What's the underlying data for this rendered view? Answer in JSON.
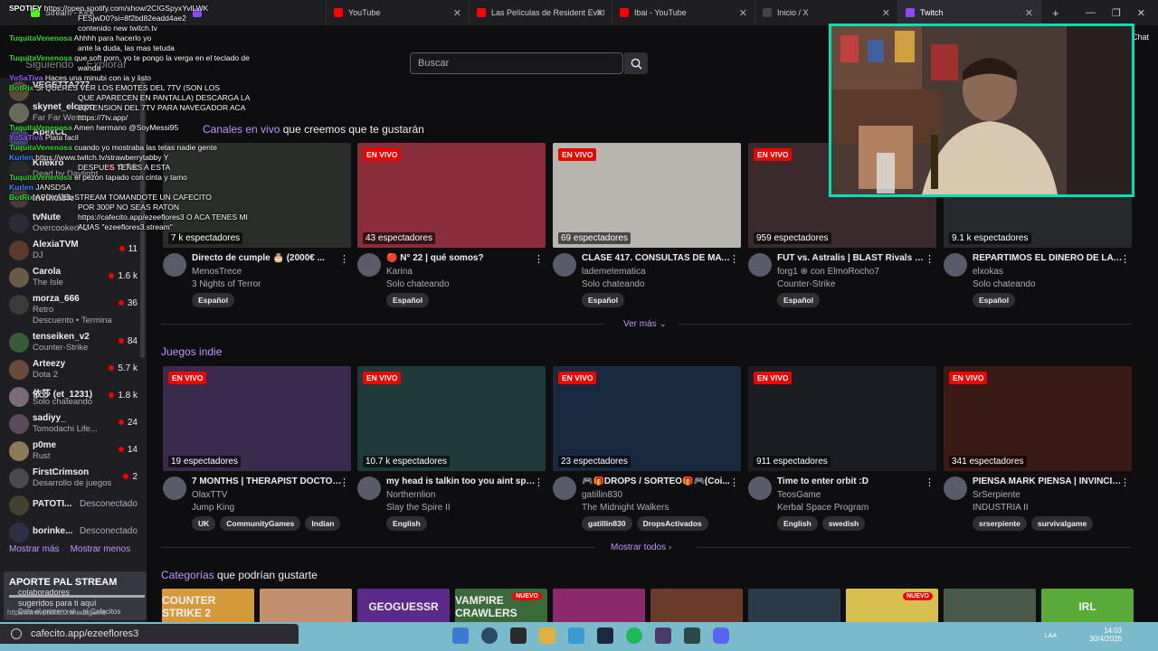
{
  "browser": {
    "tabs": [
      {
        "label": "Stream - Kick",
        "color": "#53fc18"
      },
      {
        "label": "YouTube",
        "color": "#ff0000"
      },
      {
        "label": "Las Películas de Resident Evil NO",
        "color": "#ff0000"
      },
      {
        "label": "Ibai - YouTube",
        "color": "#ff0000"
      },
      {
        "label": "Inicio / X",
        "color": "#444444"
      },
      {
        "label": "Twitch",
        "color": "#9146ff"
      }
    ],
    "new_tab": "+",
    "url": "cafecito.app/ezeeflores3",
    "status_url": "https://www.twitch.tv/tedsgame"
  },
  "header": {
    "search_placeholder": "Buscar",
    "chat_label": "Chat",
    "nav_items": [
      "Siguiendo",
      "Explorar"
    ]
  },
  "sidebar": {
    "items": [
      {
        "name": "VEGETTA777",
        "game": "",
        "count": ""
      },
      {
        "name": "skynet_elcapo",
        "game": "Far Far West",
        "count": ""
      },
      {
        "name": "ApexCL",
        "game": "",
        "count": ""
      },
      {
        "name": "Knekro",
        "game": "Dead by Daylight",
        "count": "4.7 k"
      },
      {
        "name": "Invincible",
        "game": "",
        "count": ""
      },
      {
        "name": "tvNute",
        "game": "Overcooked! 2",
        "count": ""
      },
      {
        "name": "AlexiaTVM",
        "game": "DJ",
        "count": "11"
      },
      {
        "name": "Carola",
        "game": "The Isle",
        "count": "1.6 k"
      },
      {
        "name": "morza_666",
        "game": "Retro",
        "count": "36"
      },
      {
        "name": "Descuento • Termina",
        "game": "",
        "count": ""
      },
      {
        "name": "tenseiken_v2",
        "game": "Counter-Strike",
        "count": "84"
      },
      {
        "name": "Arteezy",
        "game": "Dota 2",
        "count": "5.7 k"
      },
      {
        "name": "依莎 (et_1231)",
        "game": "Solo chateando",
        "count": "1.8 k"
      },
      {
        "name": "sadiyy_",
        "game": "Tomodachi Life...",
        "count": "24"
      },
      {
        "name": "p0me",
        "game": "Rust",
        "count": "14"
      },
      {
        "name": "FirstCrimson",
        "game": "Desarrollo de juegos",
        "count": "2"
      },
      {
        "name": "PATOTI...",
        "game": "",
        "count": "",
        "status": "Desconectado"
      },
      {
        "name": "borinke...",
        "game": "",
        "count": "",
        "status": "Desconectado"
      }
    ],
    "show_more": "Mostrar más",
    "show_less": "Mostrar menos"
  },
  "chat_overlay": [
    {
      "user": "SPOTIFY",
      "text": "https://open.spotify.com/show/2CIGSpyxYvlLWK"
    },
    {
      "user": "",
      "text": "FESjwD0?si=8f2bd82eadd4ae2"
    },
    {
      "user": "",
      "text": "contenido new twitch.tv"
    },
    {
      "user": "TuquitaVenenosa",
      "text": "Ahhhh para hacerlo yo"
    },
    {
      "user": "",
      "text": "ante la duda, las mas tetuda"
    },
    {
      "user": "TuquitaVenenosa",
      "text": "que soft porn, yo te pongo la verga en el teclado de"
    },
    {
      "user": "",
      "text": "wanda"
    },
    {
      "user": "YoSaTiva",
      "text": "Haces una minubi con ia y listo"
    },
    {
      "user": "BotRix",
      "text": "SI QUERES VER LOS EMOTES DEL 7TV (SON LOS"
    },
    {
      "user": "",
      "text": "QUE APARECEN EN PANTALLA) DESCARGA LA"
    },
    {
      "user": "",
      "text": "EXTENSION DEL 7TV PARA NAVEGADOR ACA"
    },
    {
      "user": "",
      "text": "https://7tv.app/"
    },
    {
      "user": "TuquitaVenenosa",
      "text": "Amen hermano @SoyMessi95"
    },
    {
      "user": "YoSaTiva",
      "text": "Plata facil"
    },
    {
      "user": "TuquitaVenenosa",
      "text": "cuando yo mostraba las tetas nadie gente"
    },
    {
      "user": "Kurlen",
      "text": "https://www.twitch.tv/strawberrytabby Y"
    },
    {
      "user": "",
      "text": "DESPUES TENES A ESTA"
    },
    {
      "user": "TuquitaVenenosa",
      "text": "el pezon tapado con cinta y tamo"
    },
    {
      "user": "Kurlen",
      "text": "JANSDSA"
    },
    {
      "user": "BotRix",
      "text": "APOYA EL STREAM TOMANDOTE UN CAFECITO"
    },
    {
      "user": "",
      "text": "POR 300P NO SEAS RATON"
    },
    {
      "user": "",
      "text": "https://cafecito.app/ezeeflores3 O ACA TENES MI"
    },
    {
      "user": "",
      "text": "ALIAS \"ezeeflores3.stream\""
    }
  ],
  "section1": {
    "title_prefix": "Canales en vivo",
    "title_suffix": " que creemos que te gustarán",
    "see_more": "Ver más",
    "cards": [
      {
        "live": "",
        "viewers": "7 k espectadores",
        "title": "Directo de cumple 🎂 (2000€ ...",
        "channel": "MenosTrece",
        "game": "3 Nights of Terror",
        "tags": [
          "Español"
        ],
        "color": "#2a2d2a"
      },
      {
        "live": "EN VIVO",
        "viewers": "43 espectadores",
        "title": "🔴 N° 22 | qué somos?",
        "channel": "Karina",
        "game": "Solo chateando",
        "tags": [
          "Español"
        ],
        "color": "#8a2d3a"
      },
      {
        "live": "EN VIVO",
        "viewers": "69 espectadores",
        "title": "CLASE 417. CONSULTAS DE MATE...",
        "channel": "lademetematica",
        "game": "Solo chateando",
        "tags": [
          "Español"
        ],
        "color": "#b8b4ae"
      },
      {
        "live": "EN VIVO",
        "viewers": "959 espectadores",
        "title": "FUT vs. Astralis | BLAST Rivals 20...",
        "channel": "forg1 ⊕ con ElmoRocho7",
        "game": "Counter-Strike",
        "tags": [
          "Español"
        ],
        "color": "#3a2a2e"
      },
      {
        "live": "",
        "viewers": "9.1 k espectadores",
        "title": "REPARTIMOS EL DINERO DE LA A...",
        "channel": "elxokas",
        "game": "Solo chateando",
        "tags": [
          "Español"
        ],
        "color": "#26282c"
      }
    ]
  },
  "section2": {
    "title": "Juegos indie",
    "show_all": "Mostrar todos",
    "cards": [
      {
        "live": "EN VIVO",
        "viewers": "19 espectadores",
        "title": "7 MONTHS | THERAPIST DOCTOR...",
        "channel": "OlaxTTV",
        "game": "Jump King",
        "tags": [
          "UK",
          "CommunityGames",
          "Indian"
        ],
        "color": "#3a2a4e"
      },
      {
        "live": "EN VIVO",
        "viewers": "10.7 k espectadores",
        "title": "my head is talkin too you aint spe...",
        "channel": "Northernlion",
        "game": "Slay the Spire II",
        "tags": [
          "English"
        ],
        "color": "#1e3a3a"
      },
      {
        "live": "EN VIVO",
        "viewers": "23 espectadores",
        "title": "🎮🎁DROPS / SORTEO🎁🎮(Coi...",
        "channel": "gatillin830",
        "game": "The Midnight Walkers",
        "tags": [
          "gatillin830",
          "DropsActivados"
        ],
        "color": "#1a2a3e"
      },
      {
        "live": "EN VIVO",
        "viewers": "911 espectadores",
        "title": "Time to enter orbit :D",
        "channel": "TeosGame",
        "game": "Kerbal Space Program",
        "tags": [
          "English",
          "swedish"
        ],
        "color": "#1a1e22"
      },
      {
        "live": "EN VIVO",
        "viewers": "341 espectadores",
        "title": "PIENSA MARK PIENSA | INVINCIB...",
        "channel": "SrSerpiente",
        "game": "INDUSTRIA II",
        "tags": [
          "srserpiente",
          "survivalgame"
        ],
        "color": "#3a1a14"
      }
    ]
  },
  "section3": {
    "title_prefix": "Categorías",
    "title_suffix": " que podrían gustarte",
    "categories": [
      {
        "label": "COUNTER STRIKE 2",
        "color": "#d49a3a",
        "new": ""
      },
      {
        "label": "",
        "color": "#c09070",
        "new": ""
      },
      {
        "label": "GEOGUESSR",
        "color": "#5a2a8a",
        "new": ""
      },
      {
        "label": "VAMPIRE CRAWLERS",
        "color": "#3a6a3a",
        "new": "NUEVO"
      },
      {
        "label": "",
        "color": "#8a2a6a",
        "new": ""
      },
      {
        "label": "",
        "color": "#6a3a2a",
        "new": ""
      },
      {
        "label": "",
        "color": "#2a3a4a",
        "new": ""
      },
      {
        "label": "",
        "color": "#d8c050",
        "new": "NUEVO"
      },
      {
        "label": "",
        "color": "#4a5a4a",
        "new": ""
      },
      {
        "label": "IRL",
        "color": "#5aaa3a",
        "new": ""
      },
      {
        "label": "",
        "color": "#8a1a1a",
        "new": ""
      }
    ]
  },
  "overlay": {
    "title": "APORTE PAL STREAM",
    "line1": "colaboradores",
    "line2": "sugeridos para ti aquí",
    "line3": "Dale el primero al ...el Cafecitos"
  },
  "taskbar": {
    "time": "14:03",
    "date": "30/4/2026",
    "lang": "LAA"
  }
}
